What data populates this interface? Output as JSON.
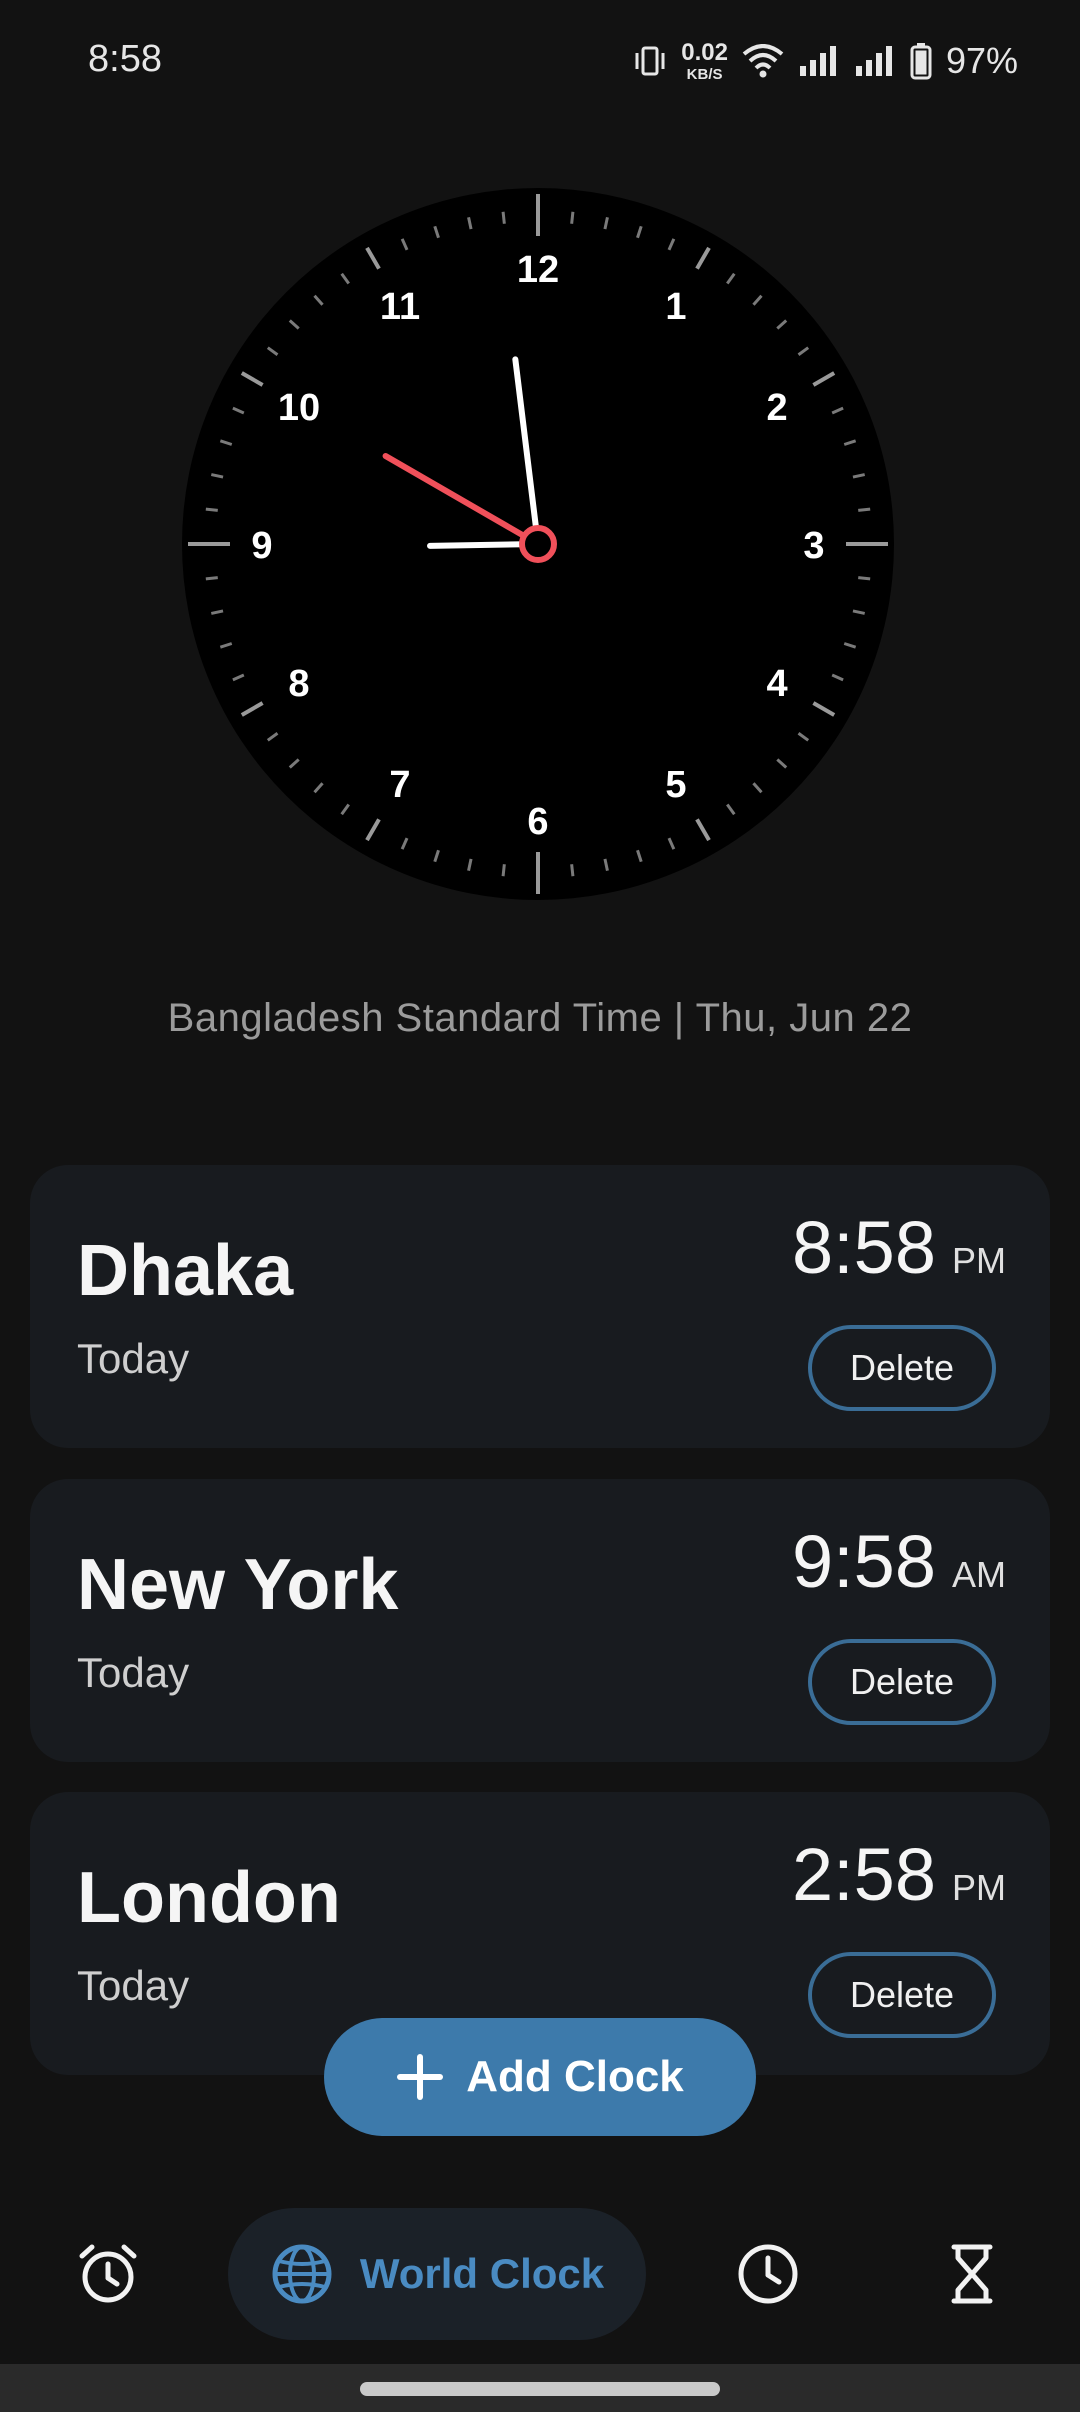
{
  "status_bar": {
    "time": "8:58",
    "net_speed_value": "0.02",
    "net_speed_unit": "KB/S",
    "battery_percent": "97%"
  },
  "analog_clock": {
    "numerals": [
      "12",
      "1",
      "2",
      "3",
      "4",
      "5",
      "6",
      "7",
      "8",
      "9",
      "10",
      "11"
    ],
    "hour": 8,
    "minute": 58,
    "second": 50,
    "second_hand_color": "#f0505a"
  },
  "timezone_line": "Bangladesh Standard Time | Thu, Jun 22",
  "cities": [
    {
      "name": "Dhaka",
      "day": "Today",
      "time": "8:58",
      "ampm": "PM",
      "delete_label": "Delete"
    },
    {
      "name": "New York",
      "day": "Today",
      "time": "9:58",
      "ampm": "AM",
      "delete_label": "Delete"
    },
    {
      "name": "London",
      "day": "Today",
      "time": "2:58",
      "ampm": "PM",
      "delete_label": "Delete"
    }
  ],
  "fab": {
    "label": "Add Clock"
  },
  "bottom_nav": {
    "items": [
      {
        "icon": "alarm-icon"
      },
      {
        "icon": "globe-icon",
        "label": "World Clock",
        "active": true
      },
      {
        "icon": "clock-icon"
      },
      {
        "icon": "hourglass-icon"
      }
    ]
  },
  "colors": {
    "accent": "#3d7aab",
    "accent_text": "#4a8bc2",
    "card": "#181b1f",
    "background": "#121212"
  }
}
